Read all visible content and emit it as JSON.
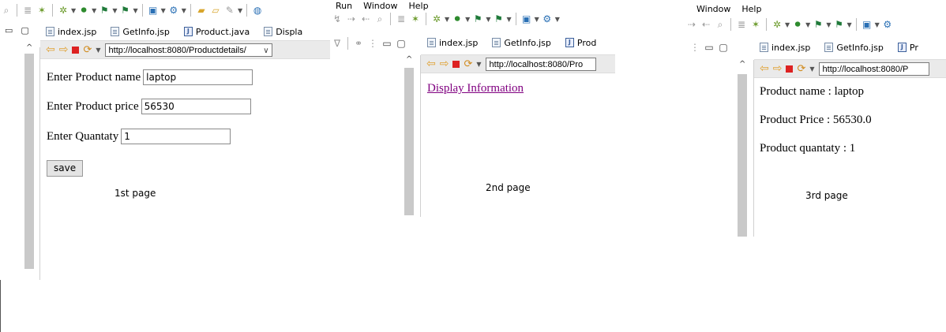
{
  "page1": {
    "tabs": [
      {
        "label": "index.jsp",
        "icon": "jsp-file-icon"
      },
      {
        "label": "GetInfo.jsp",
        "icon": "jsp-file-icon"
      },
      {
        "label": "Product.java",
        "icon": "java-file-icon"
      },
      {
        "label": "Displa",
        "icon": "jsp-file-icon"
      }
    ],
    "url": "http://localhost:8080/Productdetails/",
    "form": {
      "name_label": "Enter Product name",
      "name_value": "laptop",
      "price_label": "Enter Product price",
      "price_value": "56530",
      "qty_label": "Enter Quantaty",
      "qty_value": "1",
      "save_label": "save"
    },
    "caption": "1st page"
  },
  "page2": {
    "menu": [
      "Run",
      "Window",
      "Help"
    ],
    "tabs": [
      {
        "label": "index.jsp",
        "icon": "jsp-file-icon"
      },
      {
        "label": "GetInfo.jsp",
        "icon": "jsp-file-icon"
      },
      {
        "label": "Prod",
        "icon": "java-file-icon"
      }
    ],
    "url": "http://localhost:8080/Pro",
    "link_text": "Display Information",
    "caption": "2nd page"
  },
  "page3": {
    "menu": [
      "Window",
      "Help"
    ],
    "tabs": [
      {
        "label": "index.jsp",
        "icon": "jsp-file-icon"
      },
      {
        "label": "GetInfo.jsp",
        "icon": "jsp-file-icon"
      },
      {
        "label": "Pr",
        "icon": "java-file-icon"
      }
    ],
    "url": "http://localhost:8080/P",
    "lines": [
      "Product name : laptop",
      "Product Price : 56530.0",
      "Product quantaty : 1"
    ],
    "caption": "3rd page"
  },
  "colors": {
    "link": "#800080",
    "stop": "#dd2222",
    "nav_arrow": "#e0a030",
    "gutter": "#c9c9c9"
  }
}
